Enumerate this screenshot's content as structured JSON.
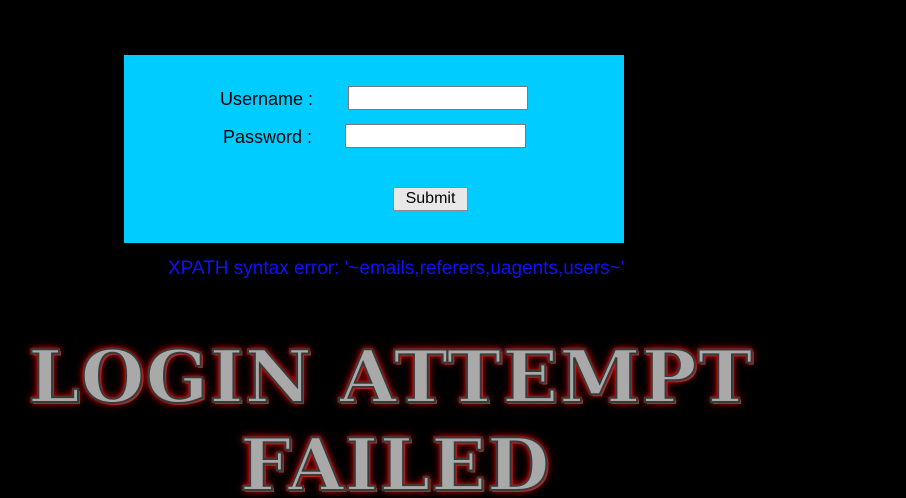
{
  "login_form": {
    "username_label": "Username :",
    "password_label": "Password :",
    "username_value": "",
    "password_value": "",
    "submit_label": "Submit",
    "panel_color": "#00ccff"
  },
  "error": {
    "message": "XPATH syntax error: '~emails,referers,uagents,users~'",
    "color": "#1010ff"
  },
  "banner": {
    "line1": "LOGIN ATTEMPT",
    "line2": "FAILED",
    "glow_color": "#ff0000"
  }
}
